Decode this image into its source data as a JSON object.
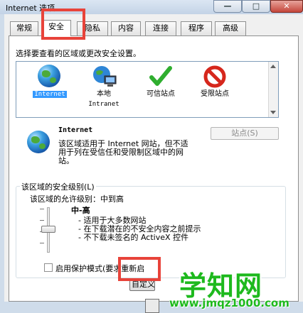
{
  "window": {
    "title": "Internet 选项",
    "min_label": "—",
    "max_label": "□",
    "close_label": "✕"
  },
  "tabs": [
    {
      "label": "常规",
      "active": false
    },
    {
      "label": "安全",
      "active": true
    },
    {
      "label": "隐私",
      "active": false
    },
    {
      "label": "内容",
      "active": false
    },
    {
      "label": "连接",
      "active": false
    },
    {
      "label": "程序",
      "active": false
    },
    {
      "label": "高级",
      "active": false
    }
  ],
  "prompt": "选择要查看的区域或更改安全设置。",
  "zones": [
    {
      "label": "Internet",
      "sublabel": "",
      "icon": "globe-icon",
      "selected": true
    },
    {
      "label": "本地",
      "sublabel": "Intranet",
      "icon": "intranet-icon",
      "selected": false
    },
    {
      "label": "可信站点",
      "sublabel": "",
      "icon": "checkmark-icon",
      "selected": false
    },
    {
      "label": "受限站点",
      "sublabel": "",
      "icon": "restricted-icon",
      "selected": false
    }
  ],
  "zone_info": {
    "title": "Internet",
    "description": "该区域适用于 Internet 网站，但不适用于列在受信任和受限制区域中的网站。",
    "sites_button": "站点(S)"
  },
  "security_level": {
    "group_title": "该区域的安全级别(L)",
    "allowed_label": "该区域的允许级别：中到高",
    "level_name": "中-高",
    "bullets": [
      "- 适用于大多数网站",
      "- 在下载潜在的不安全内容之前提示",
      "- 不下载未签名的 ActiveX 控件"
    ],
    "slider_level": 0.5
  },
  "protected_mode": {
    "label": "启用保护模式(要求重新启",
    "checked": false
  },
  "custom_button": "自定义",
  "watermark": {
    "text": "学知网",
    "url": "www.jmqz1000.com"
  },
  "colors": {
    "highlight": "#e8433a",
    "selection": "#3399ff",
    "watermark": "#1db91d"
  }
}
